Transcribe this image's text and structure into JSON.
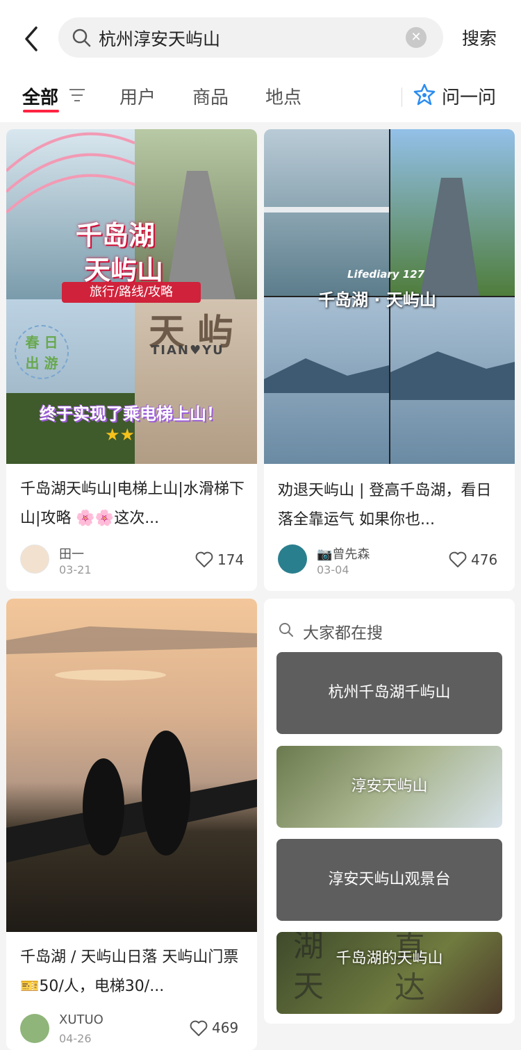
{
  "search": {
    "query": "杭州淳安天屿山",
    "submit_label": "搜索"
  },
  "tabs": [
    {
      "label": "全部"
    },
    {
      "label": "用户"
    },
    {
      "label": "商品"
    },
    {
      "label": "地点"
    }
  ],
  "ask": {
    "label": "问一问"
  },
  "posts": [
    {
      "title": "千岛湖天屿山|电梯上山|水滑梯下山|攻略 🌸🌸这次...",
      "author": "田一",
      "date": "03-21",
      "likes": "174",
      "image_text": {
        "main1": "千岛湖",
        "main2": "天屿山",
        "tag": "旅行/路线/攻略",
        "sign1": "天 屿",
        "sign2": "TIAN♥YU",
        "badge1": "春 日",
        "badge2": "出 游",
        "bottom": "终于实现了乘电梯上山！",
        "stars": "★★"
      }
    },
    {
      "title": "劝退天屿山 | 登高千岛湖，看日落全靠运气 如果你也...",
      "author": "📷曾先森",
      "date": "03-04",
      "likes": "476",
      "image_text": {
        "sub": "Lifediary 127",
        "main": "千岛湖 · 天屿山"
      }
    },
    {
      "title": "千岛湖 / 天屿山日落 天屿山门票🎫50/人，电梯30/...",
      "author": "XUTUO",
      "date": "04-26",
      "likes": "469"
    }
  ],
  "suggestions": {
    "heading": "大家都在搜",
    "items": [
      {
        "label": "杭州千岛湖千屿山"
      },
      {
        "label": "淳安天屿山"
      },
      {
        "label": "淳安天屿山观景台"
      },
      {
        "label": "千岛湖的天屿山",
        "bg_text": [
          "湖",
          "直",
          "天",
          "达"
        ]
      }
    ]
  },
  "colors": {
    "accent": "#ff2442",
    "ask_icon": "#2b8cf0"
  }
}
